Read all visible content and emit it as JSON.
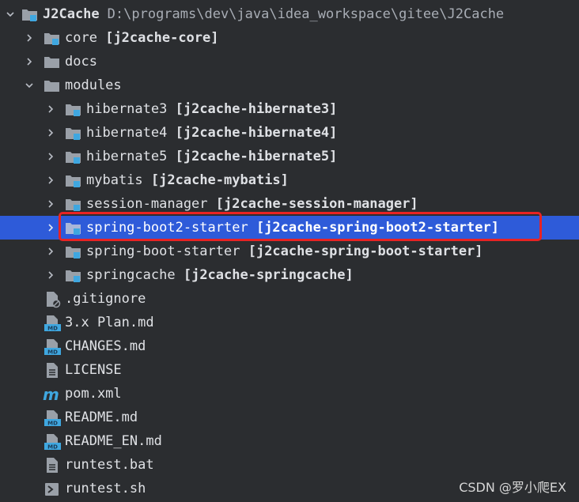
{
  "tree": {
    "root": {
      "name": "J2Cache",
      "path": "D:\\programs\\dev\\java\\idea_workspace\\gitee\\J2Cache"
    },
    "rows": [
      {
        "name": "core",
        "module": "[j2cache-core]"
      },
      {
        "name": "docs",
        "module": ""
      },
      {
        "name": "modules",
        "module": ""
      },
      {
        "name": "hibernate3",
        "module": "[j2cache-hibernate3]"
      },
      {
        "name": "hibernate4",
        "module": "[j2cache-hibernate4]"
      },
      {
        "name": "hibernate5",
        "module": "[j2cache-hibernate5]"
      },
      {
        "name": "mybatis",
        "module": "[j2cache-mybatis]"
      },
      {
        "name": "session-manager",
        "module": "[j2cache-session-manager]"
      },
      {
        "name": "spring-boot2-starter",
        "module": "[j2cache-spring-boot2-starter]"
      },
      {
        "name": "spring-boot-starter",
        "module": "[j2cache-spring-boot-starter]"
      },
      {
        "name": "springcache",
        "module": "[j2cache-springcache]"
      },
      {
        "name": ".gitignore",
        "module": ""
      },
      {
        "name": "3.x Plan.md",
        "module": ""
      },
      {
        "name": "CHANGES.md",
        "module": ""
      },
      {
        "name": "LICENSE",
        "module": ""
      },
      {
        "name": "pom.xml",
        "module": ""
      },
      {
        "name": "README.md",
        "module": ""
      },
      {
        "name": "README_EN.md",
        "module": ""
      },
      {
        "name": "runtest.bat",
        "module": ""
      },
      {
        "name": "runtest.sh",
        "module": ""
      }
    ]
  },
  "watermark": "CSDN @罗小爬EX",
  "colors": {
    "background": "#2b2d30",
    "selection": "#2e5bd9",
    "highlight_border": "#e82323",
    "module_badge": "#3fa7e0"
  },
  "icons": [
    "chevron-down-icon",
    "chevron-right-icon",
    "module-folder-icon",
    "folder-icon",
    "gitignore-file-icon",
    "markdown-file-icon",
    "text-file-icon",
    "maven-icon",
    "script-file-icon"
  ]
}
